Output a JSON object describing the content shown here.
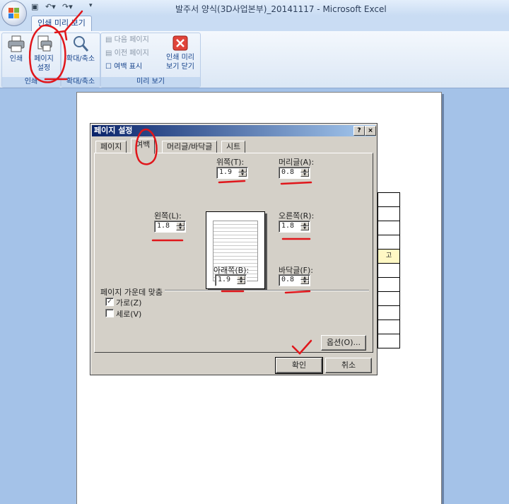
{
  "window": {
    "title": "발주서 양식(3D사업본부)_20141117 - Microsoft Excel"
  },
  "ribbon": {
    "active_tab": "인쇄 미리 보기",
    "groups": [
      {
        "label": "인쇄",
        "buttons": [
          "인쇄",
          "페이지 설정"
        ]
      },
      {
        "label": "확대/축소",
        "buttons": [
          "확대/축소"
        ]
      },
      {
        "label": "미리 보기",
        "items": [
          "다음 페이지",
          "이전 페이지",
          "여백 표시"
        ],
        "buttons": [
          "인쇄 미리 보기 닫기"
        ]
      }
    ],
    "print_label": "인쇄",
    "page_setup_label_1": "페이지",
    "page_setup_label_2": "설정",
    "zoom_label": "확대/축소",
    "next_page": "다음 페이지",
    "prev_page": "이전 페이지",
    "show_margins": "여백 표시",
    "close_label_1": "인쇄 미리",
    "close_label_2": "보기 닫기",
    "group_print": "인쇄",
    "group_zoom": "확대/축소",
    "group_preview": "미리 보기"
  },
  "sheet": {
    "cell_text": "고"
  },
  "dialog": {
    "title": "페이지 설정",
    "help": "?",
    "close": "×",
    "tabs": [
      "페이지",
      "여백",
      "머리글/바닥글",
      "시트"
    ],
    "active_tab": "여백",
    "fields": {
      "top": {
        "label": "위쪽(T):",
        "value": "1.9"
      },
      "header": {
        "label": "머리글(A):",
        "value": "0.8"
      },
      "left": {
        "label": "왼쪽(L):",
        "value": "1.8"
      },
      "right": {
        "label": "오른쪽(R):",
        "value": "1.8"
      },
      "bottom": {
        "label": "아래쪽(B):",
        "value": "1.9"
      },
      "footer": {
        "label": "바닥글(F):",
        "value": "0.8"
      }
    },
    "center_on_page": {
      "label": "페이지 가운데 맞춤",
      "horizontal": {
        "label": "가로(Z)",
        "checked": true
      },
      "vertical": {
        "label": "세로(V)",
        "checked": false
      }
    },
    "options_button": "옵션(O)...",
    "ok_button": "확인",
    "cancel_button": "취소"
  },
  "colors": {
    "annotation": "#e0161b",
    "title_bar": "#0a246a",
    "ribbon_text": "#15428b"
  }
}
